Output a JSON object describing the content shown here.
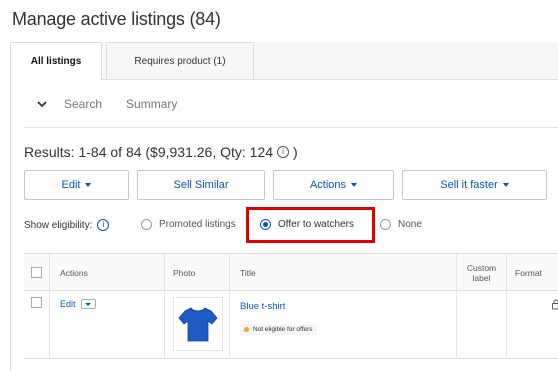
{
  "page": {
    "title": "Manage active listings (84)"
  },
  "tabs": [
    {
      "label": "All listings",
      "active": true
    },
    {
      "label": "Requires product (1)",
      "active": false
    }
  ],
  "toolbar": {
    "search_label": "Search",
    "summary_label": "Summary"
  },
  "results": {
    "text": "Results: 1-84 of 84 ($9,931.26, Qty: 124",
    "close": ")",
    "info_glyph": "i"
  },
  "actions": {
    "edit_label": "Edit",
    "sell_similar_label": "Sell Similar",
    "actions_label": "Actions",
    "sell_faster_label": "Sell it faster"
  },
  "eligibility": {
    "label": "Show eligibility:",
    "info_glyph": "i",
    "options": [
      {
        "label": "Promoted listings",
        "selected": false
      },
      {
        "label": "Offer to watchers",
        "selected": true
      },
      {
        "label": "None",
        "selected": false
      }
    ],
    "highlight_color": "#e00000"
  },
  "table": {
    "headers": {
      "actions": "Actions",
      "photo": "Photo",
      "title": "Title",
      "custom_label_1": "Custom",
      "custom_label_2": "label",
      "format": "Format"
    },
    "rows": [
      {
        "edit_label": "Edit",
        "title": "Blue t-shirt",
        "badge": "Not eligible for offers",
        "badge_color": "#f5a623",
        "photo_icon": "blue-tshirt",
        "format_icon": "auction-icon"
      }
    ]
  },
  "colors": {
    "link": "#0654ba",
    "tshirt": "#1e5bc6"
  }
}
